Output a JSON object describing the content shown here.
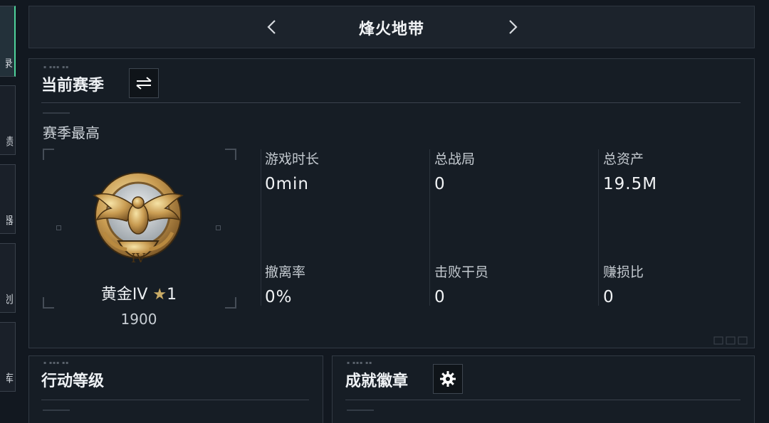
{
  "header": {
    "title": "烽火地带",
    "prev_icon": "chevron-left-icon",
    "next_icon": "chevron-right-icon"
  },
  "left_tabs": [
    {
      "label": "录",
      "active": true
    },
    {
      "label": "绩",
      "active": false
    },
    {
      "label": "器",
      "active": false
    },
    {
      "label": "划",
      "active": false
    },
    {
      "label": "库",
      "active": false
    }
  ],
  "current_season": {
    "title": "当前赛季",
    "switch_icon": "swap-arrows-icon",
    "best_label": "赛季最高",
    "rank": {
      "name": "黄金IV",
      "star_icon": "★",
      "stars": "1",
      "score": "1900",
      "medal_numeral": "IV"
    },
    "stats": [
      {
        "label": "游戏时长",
        "value": "0min"
      },
      {
        "label": "总战局",
        "value": "0"
      },
      {
        "label": "总资产",
        "value": "19.5M"
      },
      {
        "label": "撤离率",
        "value": "0%"
      },
      {
        "label": "击败干员",
        "value": "0"
      },
      {
        "label": "赚损比",
        "value": "0"
      }
    ]
  },
  "action_level": {
    "title": "行动等级"
  },
  "achievements": {
    "title": "成就徽章",
    "settings_icon": "gear-icon"
  },
  "colors": {
    "background": "#121820",
    "panel": "#161d25",
    "active_accent": "#4ed39a",
    "gold": "#c9ab66"
  }
}
